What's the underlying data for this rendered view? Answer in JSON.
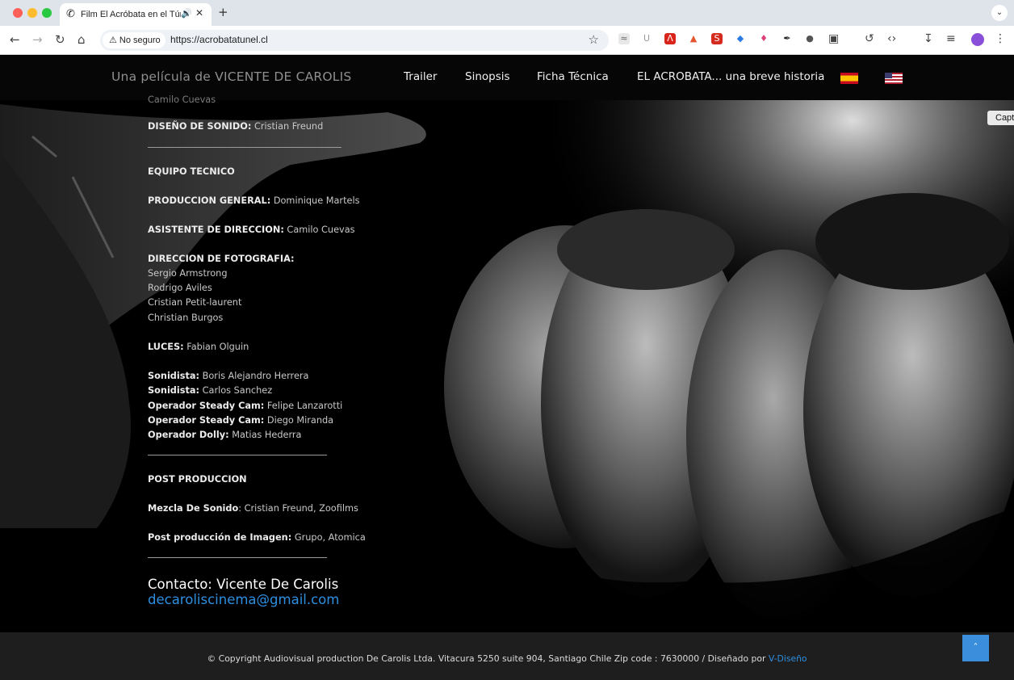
{
  "browser": {
    "tab_title": "Film El Acróbata en el Túnel",
    "security_label": "No seguro",
    "url": "https://acrobatatunel.cl",
    "icons": [
      "back-icon",
      "forward-icon",
      "reload-icon",
      "home-icon",
      "bookmark-star-icon",
      "downloads-icon",
      "reading-list-icon",
      "profile-icon",
      "menu-icon"
    ]
  },
  "site": {
    "tagline": "Una película de VICENTE DE CAROLIS",
    "nav": [
      "Trailer",
      "Sinopsis",
      "Ficha Técnica",
      "EL ACROBATA... una breve historia"
    ],
    "flags": [
      "spanish-flag-icon",
      "us-flag-icon"
    ]
  },
  "credits": {
    "cut_top_text": "Camilo Cuevas",
    "sound_design": {
      "label": "DISEÑO DE SONIDO:",
      "value": " Cristian Freund"
    },
    "team_heading": "EQUIPO TECNICO",
    "general_production": {
      "label": "PRODUCCION GENERAL:",
      "value": " Dominique Martels"
    },
    "assistant_director": {
      "label": "ASISTENTE DE DIRECCION:",
      "value": " Camilo Cuevas"
    },
    "photography": {
      "label": "DIRECCION DE FOTOGRAFIA:",
      "names": [
        "Sergio Armstrong",
        "Rodrigo Aviles",
        "Cristian Petit-laurent",
        "Christian Burgos"
      ]
    },
    "lights": {
      "label": "LUCES:",
      "value": " Fabian Olguin"
    },
    "crew": [
      {
        "label": "Sonidista:",
        "value": " Boris Alejandro Herrera"
      },
      {
        "label": "Sonidista:",
        "value": " Carlos Sanchez"
      },
      {
        "label": "Operador Steady Cam:",
        "value": " Felipe Lanzarotti"
      },
      {
        "label": "Operador Steady Cam:",
        "value": " Diego Miranda"
      },
      {
        "label": "Operador Dolly:",
        "value": " Matias Hederra"
      }
    ],
    "post_heading": "POST PRODUCCION",
    "sound_mix": {
      "label": "Mezcla De Sonido",
      "value": ": Cristian Freund, Zoofilms"
    },
    "image_post": {
      "label": "Post producción de Imagen:",
      "value": " Grupo, Atomica"
    }
  },
  "contact": {
    "title": "Contacto: Vicente De Carolis",
    "email": "decaroliscinema@gmail.com"
  },
  "capture_label": "Capt",
  "footer": {
    "copyright": "© Copyright Audiovisual production De Carolis Ltda. Vitacura 5250 suite 904, Santiago Chile Zip code : 7630000 / Diseñado por ",
    "designer": "V-Diseño"
  }
}
